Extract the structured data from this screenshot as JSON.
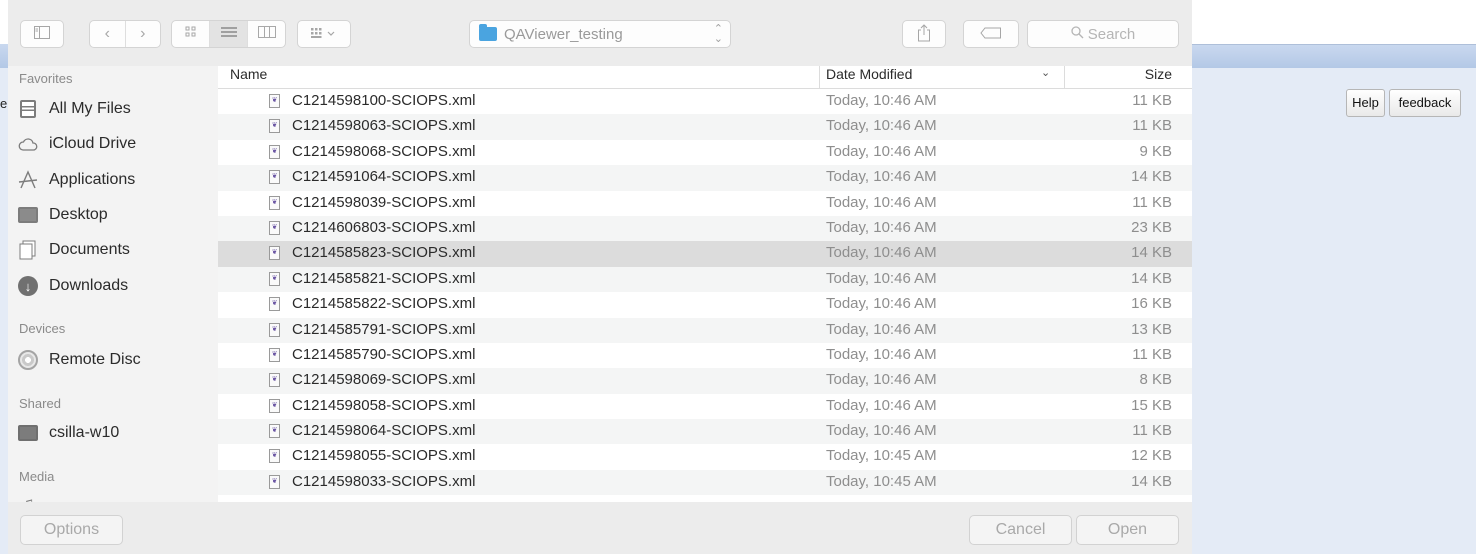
{
  "background_page": {
    "edge_letter": "e",
    "help_label": "Help",
    "feedback_label": "feedback"
  },
  "toolbar": {
    "path_label": "QAViewer_testing",
    "search_placeholder": "Search",
    "icons": {
      "sidebar": "sidebar-icon",
      "back": "chevron-left-icon",
      "forward": "chevron-right-icon",
      "icon_view": "icon-view-icon",
      "list_view": "list-view-icon",
      "column_view": "column-view-icon",
      "arrange": "arrange-icon",
      "share": "share-icon",
      "tag": "tag-icon",
      "search": "search-icon"
    }
  },
  "sidebar": {
    "favorites_heading": "Favorites",
    "devices_heading": "Devices",
    "shared_heading": "Shared",
    "media_heading": "Media",
    "favorites": [
      {
        "label": "All My Files",
        "icon": "all-files-icon"
      },
      {
        "label": "iCloud Drive",
        "icon": "cloud-icon"
      },
      {
        "label": "Applications",
        "icon": "applications-icon"
      },
      {
        "label": "Desktop",
        "icon": "desktop-icon"
      },
      {
        "label": "Documents",
        "icon": "documents-icon"
      },
      {
        "label": "Downloads",
        "icon": "downloads-icon"
      }
    ],
    "devices": [
      {
        "label": "Remote Disc",
        "icon": "disc-icon"
      }
    ],
    "shared": [
      {
        "label": "csilla-w10",
        "icon": "computer-icon"
      }
    ]
  },
  "filelist": {
    "columns": {
      "name": "Name",
      "date": "Date Modified",
      "size": "Size"
    },
    "sort_indicator": "chevron-down-icon",
    "rows": [
      {
        "name": "C1214598100-SCIOPS.xml",
        "date": "Today, 10:46 AM",
        "size": "11 KB"
      },
      {
        "name": "C1214598063-SCIOPS.xml",
        "date": "Today, 10:46 AM",
        "size": "11 KB"
      },
      {
        "name": "C1214598068-SCIOPS.xml",
        "date": "Today, 10:46 AM",
        "size": "9 KB"
      },
      {
        "name": "C1214591064-SCIOPS.xml",
        "date": "Today, 10:46 AM",
        "size": "14 KB"
      },
      {
        "name": "C1214598039-SCIOPS.xml",
        "date": "Today, 10:46 AM",
        "size": "11 KB"
      },
      {
        "name": "C1214606803-SCIOPS.xml",
        "date": "Today, 10:46 AM",
        "size": "23 KB"
      },
      {
        "name": "C1214585823-SCIOPS.xml",
        "date": "Today, 10:46 AM",
        "size": "14 KB",
        "selected": true
      },
      {
        "name": "C1214585821-SCIOPS.xml",
        "date": "Today, 10:46 AM",
        "size": "14 KB"
      },
      {
        "name": "C1214585822-SCIOPS.xml",
        "date": "Today, 10:46 AM",
        "size": "16 KB"
      },
      {
        "name": "C1214585791-SCIOPS.xml",
        "date": "Today, 10:46 AM",
        "size": "13 KB"
      },
      {
        "name": "C1214585790-SCIOPS.xml",
        "date": "Today, 10:46 AM",
        "size": "11 KB"
      },
      {
        "name": "C1214598069-SCIOPS.xml",
        "date": "Today, 10:46 AM",
        "size": "8 KB"
      },
      {
        "name": "C1214598058-SCIOPS.xml",
        "date": "Today, 10:46 AM",
        "size": "15 KB"
      },
      {
        "name": "C1214598064-SCIOPS.xml",
        "date": "Today, 10:46 AM",
        "size": "11 KB"
      },
      {
        "name": "C1214598055-SCIOPS.xml",
        "date": "Today, 10:45 AM",
        "size": "12 KB"
      },
      {
        "name": "C1214598033-SCIOPS.xml",
        "date": "Today, 10:45 AM",
        "size": "14 KB"
      }
    ]
  },
  "bottombar": {
    "options_label": "Options",
    "cancel_label": "Cancel",
    "open_label": "Open"
  }
}
